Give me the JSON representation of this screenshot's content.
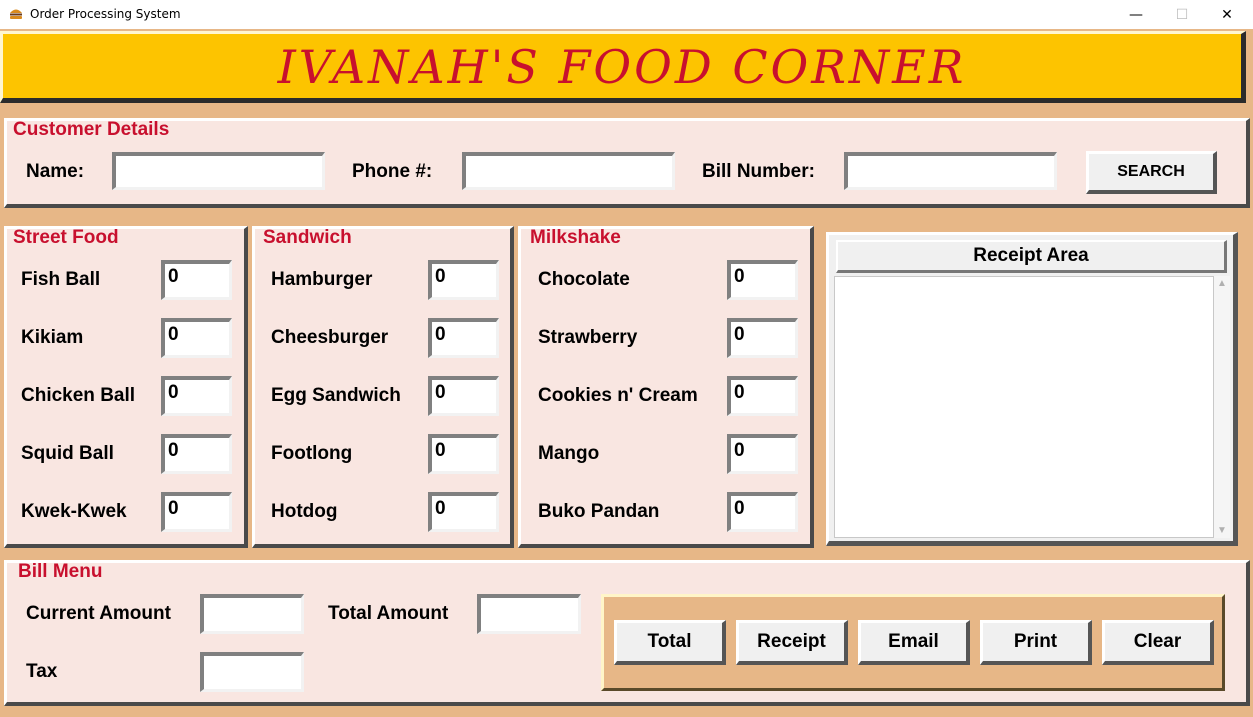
{
  "window": {
    "title": "Order Processing System",
    "minimize_glyph": "—",
    "maximize_glyph": "☐",
    "close_glyph": "✕",
    "app_icon": "burger-icon"
  },
  "banner": {
    "title": "IVANAH'S FOOD CORNER"
  },
  "customer": {
    "title": "Customer Details",
    "name_label": "Name:",
    "name_value": "",
    "phone_label": "Phone #:",
    "phone_value": "",
    "bill_label": "Bill Number:",
    "bill_value": "",
    "search_label": "SEARCH"
  },
  "street_food": {
    "title": "Street Food",
    "items": [
      {
        "label": "Fish Ball",
        "qty": "0"
      },
      {
        "label": "Kikiam",
        "qty": "0"
      },
      {
        "label": "Chicken Ball",
        "qty": "0"
      },
      {
        "label": "Squid Ball",
        "qty": "0"
      },
      {
        "label": "Kwek-Kwek",
        "qty": "0"
      }
    ]
  },
  "sandwich": {
    "title": "Sandwich",
    "items": [
      {
        "label": "Hamburger",
        "qty": "0"
      },
      {
        "label": "Cheesburger",
        "qty": "0"
      },
      {
        "label": "Egg Sandwich",
        "qty": "0"
      },
      {
        "label": "Footlong",
        "qty": "0"
      },
      {
        "label": "Hotdog",
        "qty": "0"
      }
    ]
  },
  "milkshake": {
    "title": "Milkshake",
    "items": [
      {
        "label": "Chocolate",
        "qty": "0"
      },
      {
        "label": "Strawberry",
        "qty": "0"
      },
      {
        "label": "Cookies n' Cream",
        "qty": "0"
      },
      {
        "label": "Mango",
        "qty": "0"
      },
      {
        "label": "Buko Pandan",
        "qty": "0"
      }
    ]
  },
  "receipt": {
    "title": "Receipt Area",
    "content": ""
  },
  "bill": {
    "title": "Bill Menu",
    "current_label": "Current Amount",
    "current_value": "",
    "total_label": "Total Amount",
    "total_value": "",
    "tax_label": "Tax",
    "tax_value": ""
  },
  "buttons": {
    "total": "Total",
    "receipt": "Receipt",
    "email": "Email",
    "print": "Print",
    "clear": "Clear"
  },
  "colors": {
    "banner_bg": "#fdc400",
    "banner_text": "#c8102e",
    "panel_bg": "#f9e6e1",
    "window_bg": "#e7b787",
    "section_title": "#c8102e"
  }
}
